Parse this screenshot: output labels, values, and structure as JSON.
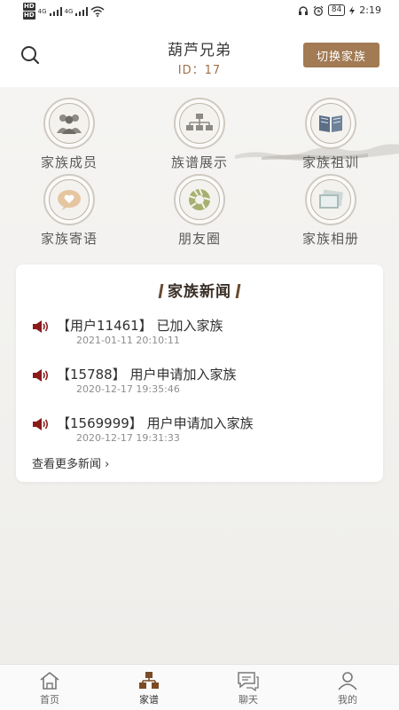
{
  "status_bar": {
    "time": "2:19",
    "battery": "84",
    "network": "4G"
  },
  "header": {
    "title": "葫芦兄弟",
    "id_text": "ID：17",
    "switch_label": "切换家族"
  },
  "grid": [
    {
      "label": "家族成员",
      "icon": "family-members-icon"
    },
    {
      "label": "族谱展示",
      "icon": "genealogy-tree-icon"
    },
    {
      "label": "家族祖训",
      "icon": "book-icon"
    },
    {
      "label": "家族寄语",
      "icon": "heart-message-icon"
    },
    {
      "label": "朋友圈",
      "icon": "moments-icon"
    },
    {
      "label": "家族相册",
      "icon": "album-icon"
    }
  ],
  "news": {
    "title": "家族新闻",
    "items": [
      {
        "text": "【用户11461】 已加入家族",
        "date": "2021-01-11 20:10:11"
      },
      {
        "text": "【15788】 用户申请加入家族",
        "date": "2020-12-17 19:35:46"
      },
      {
        "text": "【1569999】 用户申请加入家族",
        "date": "2020-12-17 19:31:33"
      }
    ],
    "more": "查看更多新闻 ›"
  },
  "tabs": [
    {
      "label": "首页",
      "active": false
    },
    {
      "label": "家谱",
      "active": true
    },
    {
      "label": "聊天",
      "active": false
    },
    {
      "label": "我的",
      "active": false
    }
  ],
  "colors": {
    "accent": "#a27a53",
    "id_color": "#a0714a",
    "active_tab": "#7a4b24",
    "speaker": "#8b1a1a"
  }
}
